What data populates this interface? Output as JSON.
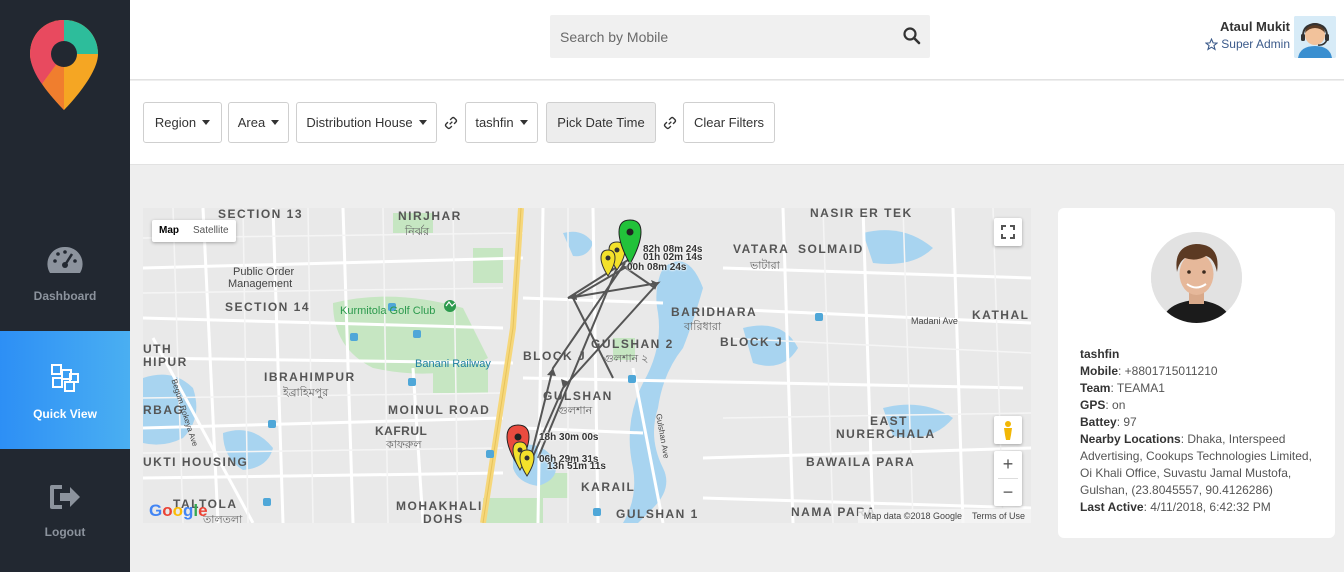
{
  "sidebar": {
    "items": [
      {
        "label": "Dashboard",
        "icon": "speedometer-icon"
      },
      {
        "label": "Quick View",
        "icon": "cubes-icon",
        "active": true
      },
      {
        "label": "Logout",
        "icon": "sign-out-icon"
      }
    ]
  },
  "header": {
    "search": {
      "placeholder": "Search by Mobile"
    },
    "user": {
      "name": "Ataul Mukit",
      "role": "Super Admin"
    }
  },
  "filters": {
    "region": "Region",
    "area": "Area",
    "distribution_house": "Distribution House",
    "user": "tashfin",
    "date": "Pick Date Time",
    "clear": "Clear Filters"
  },
  "map": {
    "type_map": "Map",
    "type_satellite": "Satellite",
    "zoom_in": "+",
    "zoom_out": "−",
    "google": "Google",
    "attribution": "Map data ©2018 Google",
    "terms": "Terms of Use",
    "areas": {
      "section13": "SECTION 13",
      "nirjhar": "NIRJHAR",
      "nirjhar_bn": "নির্ঝর",
      "nasir": "NASIR ER TEK",
      "vatara": "VATARA",
      "solmaid": "SOLMAID",
      "vatara_bn": "ভাটারা",
      "public_order": "Public Order",
      "management": "Management",
      "section14": "SECTION 14",
      "kurmitola": "Kurmitola Golf Club",
      "baridhara": "BARIDHARA",
      "baridhara_bn": "বারিধারা",
      "kathal": "KATHAL",
      "madani": "Madani Ave",
      "banani_railway": "Banani Railway",
      "block_j": "BLOCK J",
      "gulshan2": "GULSHAN 2",
      "gulshan2_bn": "গুলশান ২",
      "block_j2": "BLOCK J",
      "ibrahimpur": "IBRAHIMPUR",
      "ibrahimpur_bn": "ইব্রাহিমপুর",
      "moinul": "MOINUL ROAD",
      "gulshan": "GULSHAN",
      "gulshan_bn": "গুলশান",
      "kafrul": "KAFRUL",
      "kafrul_bn": "কাফরুল",
      "east": "EAST",
      "nurerchala": "NURERCHALA",
      "bawaila": "BAWAILA PARA",
      "ukti": "UKTI HOUSING",
      "karail": "KARAIL",
      "taltola": "TALTOLA",
      "mohakhali": "MOHAKHALI",
      "dohs": "DOHS",
      "gulshan1": "GULSHAN 1",
      "nama": "NAMA PARA",
      "rokeya": "Begum Rokeya Ave",
      "gulshan_ave": "Gulshan Ave",
      "gulshan_ave2": "Gulshan Ave",
      "hipur": "HIPUR",
      "uth": "UTH",
      "rbag": "RBAG",
      "taltola_bn": "তালতলা"
    },
    "markers": [
      {
        "label": "82h 08m 24s"
      },
      {
        "label": "01h 02m 14s"
      },
      {
        "label": "00h 08m 24s"
      },
      {
        "label": "18h 30m 00s"
      },
      {
        "label": "06h 29m 31s"
      },
      {
        "label": "13h 51m 11s"
      }
    ]
  },
  "profile": {
    "name": "tashfin",
    "mobile_label": "Mobile",
    "mobile": "+8801715011210",
    "team_label": "Team",
    "team": "TEAMA1",
    "gps_label": "GPS",
    "gps": "on",
    "battery_label": "Battey",
    "battery": "97",
    "nearby_label": "Nearby Locations",
    "nearby": "Dhaka, Interspeed Advertising, Cookups Technologies Limited, Oi Khali Office, Suvastu Jamal Mustofa, Gulshan, (23.8045557, 90.4126286)",
    "last_active_label": "Last Active",
    "last_active": "4/11/2018, 6:42:32 PM"
  }
}
